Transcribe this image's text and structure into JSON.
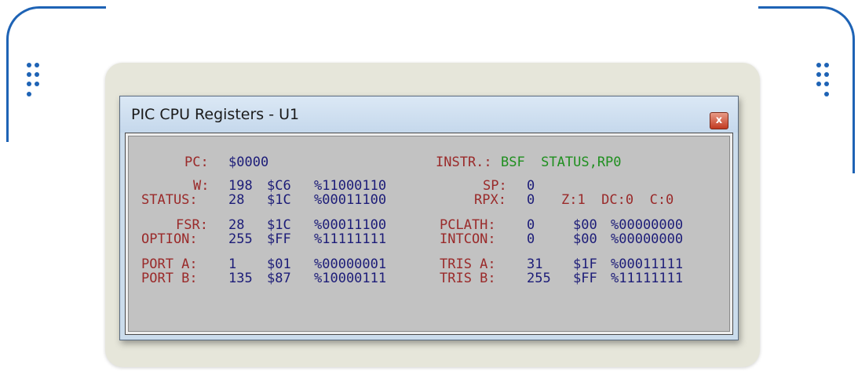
{
  "window": {
    "title": "PIC CPU Registers - U1",
    "close_label": "x"
  },
  "registers": {
    "pc": {
      "label": "PC:",
      "value": "$0000"
    },
    "instr": {
      "label": "INSTR.:",
      "value": "BSF  STATUS,RP0"
    },
    "w": {
      "label": "W:",
      "dec": "198",
      "hex": "$C6",
      "bin": "%11000110"
    },
    "status": {
      "label": "STATUS:",
      "dec": "28",
      "hex": "$1C",
      "bin": "%00011100"
    },
    "sp": {
      "label": "SP:",
      "value": "0"
    },
    "rpx": {
      "label": "RPX:",
      "value": "0",
      "flags": "Z:1  DC:0  C:0"
    },
    "fsr": {
      "label": "FSR:",
      "dec": "28",
      "hex": "$1C",
      "bin": "%00011100"
    },
    "option": {
      "label": "OPTION:",
      "dec": "255",
      "hex": "$FF",
      "bin": "%11111111"
    },
    "pclath": {
      "label": "PCLATH:",
      "dec": "0",
      "hex": "$00",
      "bin": "%00000000"
    },
    "intcon": {
      "label": "INTCON:",
      "dec": "0",
      "hex": "$00",
      "bin": "%00000000"
    },
    "porta": {
      "label": "PORT A:",
      "dec": "1",
      "hex": "$01",
      "bin": "%00000001"
    },
    "portb": {
      "label": "PORT B:",
      "dec": "135",
      "hex": "$87",
      "bin": "%10000111"
    },
    "trisa": {
      "label": "TRIS A:",
      "dec": "31",
      "hex": "$1F",
      "bin": "%00011111"
    },
    "trisb": {
      "label": "TRIS B:",
      "dec": "255",
      "hex": "$FF",
      "bin": "%11111111"
    }
  },
  "colors": {
    "label": "#9a2a2a",
    "value": "#1c1c78",
    "instruction": "#1f8f1f",
    "frame_accent": "#1e63b5"
  }
}
